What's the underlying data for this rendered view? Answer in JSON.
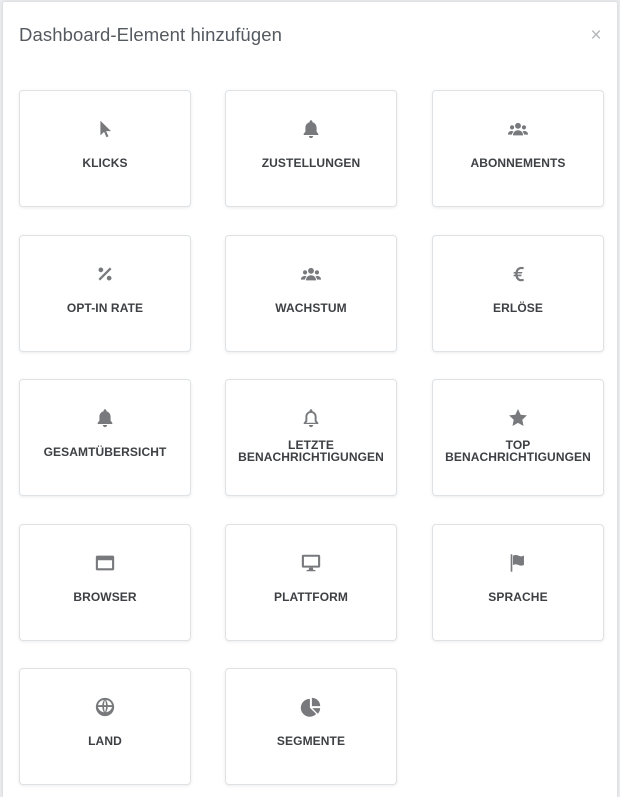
{
  "modal": {
    "title": "Dashboard-Element hinzufügen",
    "close_glyph": "×"
  },
  "cards": [
    {
      "key": "klicks",
      "label": "KLICKS",
      "icon": "cursor-icon"
    },
    {
      "key": "zustellungen",
      "label": "ZUSTELLUNGEN",
      "icon": "bell-icon"
    },
    {
      "key": "abonnements",
      "label": "ABONNEMENTS",
      "icon": "users-icon"
    },
    {
      "key": "opt-in-rate",
      "label": "OPT-IN RATE",
      "icon": "percent-icon"
    },
    {
      "key": "wachstum",
      "label": "WACHSTUM",
      "icon": "users-icon"
    },
    {
      "key": "erloese",
      "label": "ERLÖSE",
      "icon": "euro-icon"
    },
    {
      "key": "gesamtuebersicht",
      "label": "GESAMTÜBERSICHT",
      "icon": "bell-icon"
    },
    {
      "key": "letzte-benachrichtigungen",
      "label_line1": "LETZTE",
      "label_line2": "BENACHRICHTIGUNGEN",
      "icon": "bell-outline-icon"
    },
    {
      "key": "top-benachrichtigungen",
      "label_line1": "TOP",
      "label_line2": "BENACHRICHTIGUNGEN",
      "icon": "star-icon"
    },
    {
      "key": "browser",
      "label": "BROWSER",
      "icon": "browser-window-icon"
    },
    {
      "key": "plattform",
      "label": "PLATTFORM",
      "icon": "desktop-icon"
    },
    {
      "key": "sprache",
      "label": "SPRACHE",
      "icon": "flag-icon"
    },
    {
      "key": "land",
      "label": "LAND",
      "icon": "globe-icon"
    },
    {
      "key": "segmente",
      "label": "SEGMENTE",
      "icon": "pie-chart-icon"
    }
  ],
  "colors": {
    "icon": "#77797c",
    "label": "#3d4044",
    "title": "#555a60",
    "card_border": "#dfe2e5"
  }
}
